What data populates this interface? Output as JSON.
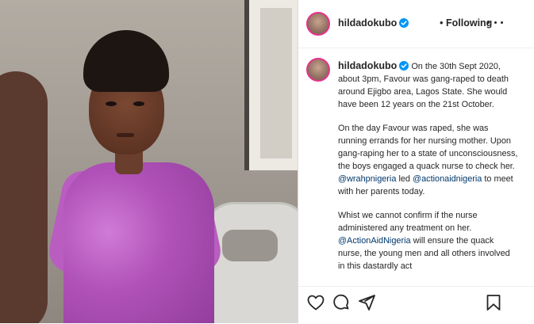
{
  "header": {
    "username": "hildadokubo",
    "separator": "•",
    "follow_status": "Following",
    "more_icon": "more-horizontal-icon"
  },
  "caption": {
    "username": "hildadokubo",
    "paragraph1_text": " On the 30th Sept 2020, about 3pm, Favour was gang-raped to death around Ejigbo area, Lagos State. She would have been 12 years on the 21st October.",
    "paragraph2_a": "On the day Favour was raped, she was running errands for her nursing mother. Upon gang-raping her to a state of unconsciousness, the boys engaged a quack nurse to check her.",
    "paragraph2_mention1": "@wrahpnigeria",
    "paragraph2_b": " led ",
    "paragraph2_mention2": "@actionaidnigeria",
    "paragraph2_c": " to meet with her parents today.",
    "paragraph3_a": "Whist we cannot confirm if the nurse administered any treatment on her. ",
    "paragraph3_mention": "@ActionAidNigeria",
    "paragraph3_b": " will ensure the quack nurse, the young men and all others involved in this dastardly act"
  },
  "actions": {
    "like_icon": "heart-icon",
    "comment_icon": "comment-icon",
    "share_icon": "paper-plane-icon",
    "save_icon": "bookmark-icon"
  },
  "colors": {
    "verified_badge": "#0095f6",
    "mention": "#00376b",
    "avatar_ring": "#e8318c"
  }
}
